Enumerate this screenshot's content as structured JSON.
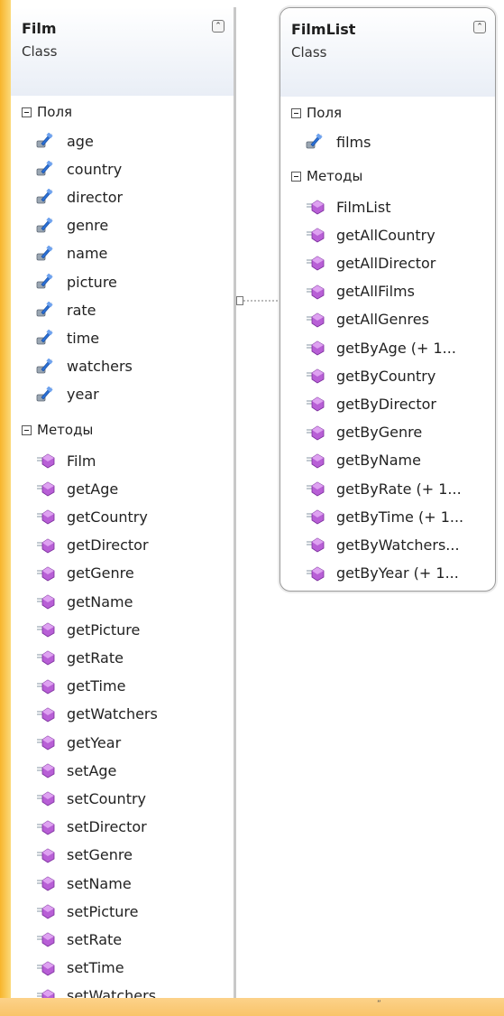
{
  "film": {
    "title": "Film",
    "subtitle": "Class",
    "fields_header": "Поля",
    "methods_header": "Методы",
    "fields": [
      "age",
      "country",
      "director",
      "genre",
      "name",
      "picture",
      "rate",
      "time",
      "watchers",
      "year"
    ],
    "methods": [
      "Film",
      "getAge",
      "getCountry",
      "getDirector",
      "getGenre",
      "getName",
      "getPicture",
      "getRate",
      "getTime",
      "getWatchers",
      "getYear",
      "setAge",
      "setCountry",
      "setDirector",
      "setGenre",
      "setName",
      "setPicture",
      "setRate",
      "setTime",
      "setWatchers"
    ]
  },
  "filmlist": {
    "title": "FilmList",
    "subtitle": "Class",
    "fields_header": "Поля",
    "methods_header": "Методы",
    "fields": [
      "films"
    ],
    "methods": [
      "FilmList",
      "getAllCountry",
      "getAllDirector",
      "getAllFilms",
      "getAllGenres",
      "getByAge (+ 1...",
      "getByCountry",
      "getByDirector",
      "getByGenre",
      "getByName",
      "getByRate (+ 1...",
      "getByTime (+ 1...",
      "getByWatchers...",
      "getByYear (+ 1..."
    ]
  },
  "colors": {
    "field_icon": "#2a6fd6",
    "method_icon": "#b85fd6",
    "accent": "#f7b52c"
  },
  "icons": {
    "field": "field-icon",
    "method": "method-icon",
    "collapse": "collapse-chevron-icon",
    "section_toggle": "minus-toggle-icon"
  }
}
